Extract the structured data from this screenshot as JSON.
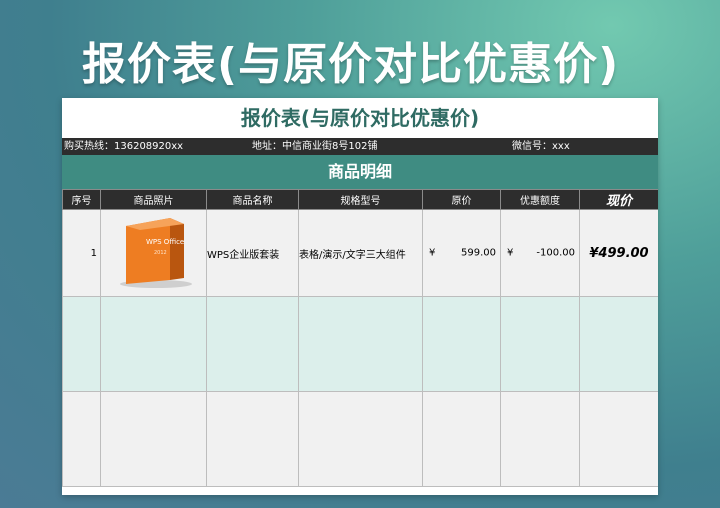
{
  "hero_title": "报价表(与原价对比优惠价)",
  "sheet": {
    "title": "报价表(与原价对比优惠价)",
    "info": {
      "hotline": "购买热线：136208920xx",
      "address": "地址：中信商业街8号102铺",
      "wechat": "微信号：xxx"
    },
    "section": "商品明细",
    "columns": {
      "index": "序号",
      "photo": "商品照片",
      "name": "商品名称",
      "spec": "规格型号",
      "original": "原价",
      "discount": "优惠额度",
      "current": "现价"
    },
    "rows": [
      {
        "index": "1",
        "product_image": "wps-office-box",
        "box_text": "WPS Office",
        "box_year": "2012",
        "name": "WPS企业版套装",
        "spec": "表格/演示/文字三大组件",
        "original_currency": "¥",
        "original": "599.00",
        "discount_currency": "¥",
        "discount": "-100.00",
        "current": "¥499.00"
      }
    ]
  },
  "colors": {
    "section_bg": "#3f8c82",
    "title_text": "#2f6b63",
    "header_bg": "#2d2d2d",
    "box_orange": "#e8731c",
    "row_tint": "#dcefeb"
  }
}
